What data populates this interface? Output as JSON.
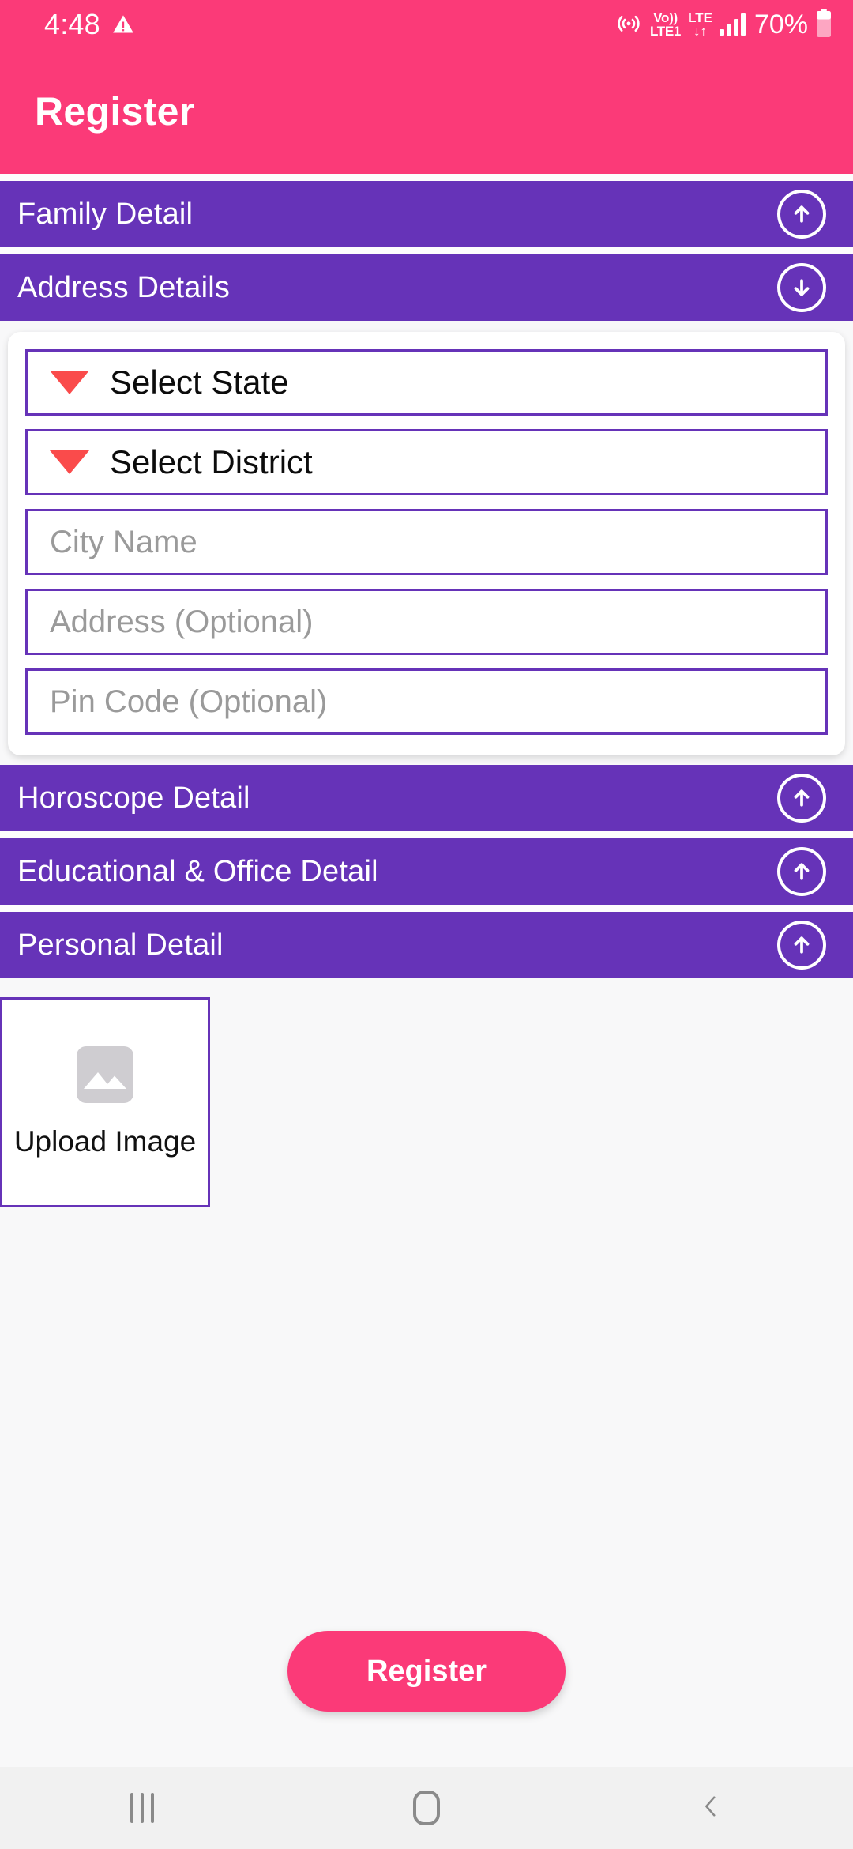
{
  "status_bar": {
    "time": "4:48",
    "warning_icon": "warning-triangle-icon",
    "hotspot_icon": "hotspot-icon",
    "volte_line1": "Vo))",
    "volte_line2": "LTE1",
    "lte_label": "LTE",
    "data_arrows": "↓↑",
    "signal_icon": "signal-bars-icon",
    "battery_percent": "70%",
    "battery_icon": "battery-icon"
  },
  "app_bar": {
    "title": "Register"
  },
  "sections": [
    {
      "label": "Family Detail",
      "state": "collapsed",
      "arrow": "arrow-up-circle-icon"
    },
    {
      "label": "Address Details",
      "state": "expanded",
      "arrow": "arrow-down-circle-icon"
    },
    {
      "label": "Horoscope Detail",
      "state": "collapsed",
      "arrow": "arrow-up-circle-icon"
    },
    {
      "label": "Educational & Office Detail",
      "state": "collapsed",
      "arrow": "arrow-up-circle-icon"
    },
    {
      "label": "Personal Detail",
      "state": "collapsed",
      "arrow": "arrow-up-circle-icon"
    }
  ],
  "address_form": {
    "state_select": {
      "value": "Select State",
      "icon": "dropdown-triangle-icon"
    },
    "district_select": {
      "value": "Select District",
      "icon": "dropdown-triangle-icon"
    },
    "city_input": {
      "value": "",
      "placeholder": "City Name"
    },
    "address_input": {
      "value": "",
      "placeholder": "Address (Optional)"
    },
    "pincode_input": {
      "value": "",
      "placeholder": "Pin Code (Optional)"
    }
  },
  "upload": {
    "label": "Upload Image",
    "icon": "image-placeholder-icon"
  },
  "submit": {
    "label": "Register"
  },
  "nav_bar": {
    "recents": "recents-icon",
    "home": "home-icon",
    "back": "back-chevron-icon"
  },
  "colors": {
    "pink": "#fb3a78",
    "purple": "#6633b8",
    "triangle_red": "#fa4b4b",
    "page_bg": "#f8f8f9",
    "placeholder_grey": "#9a9a9a"
  }
}
